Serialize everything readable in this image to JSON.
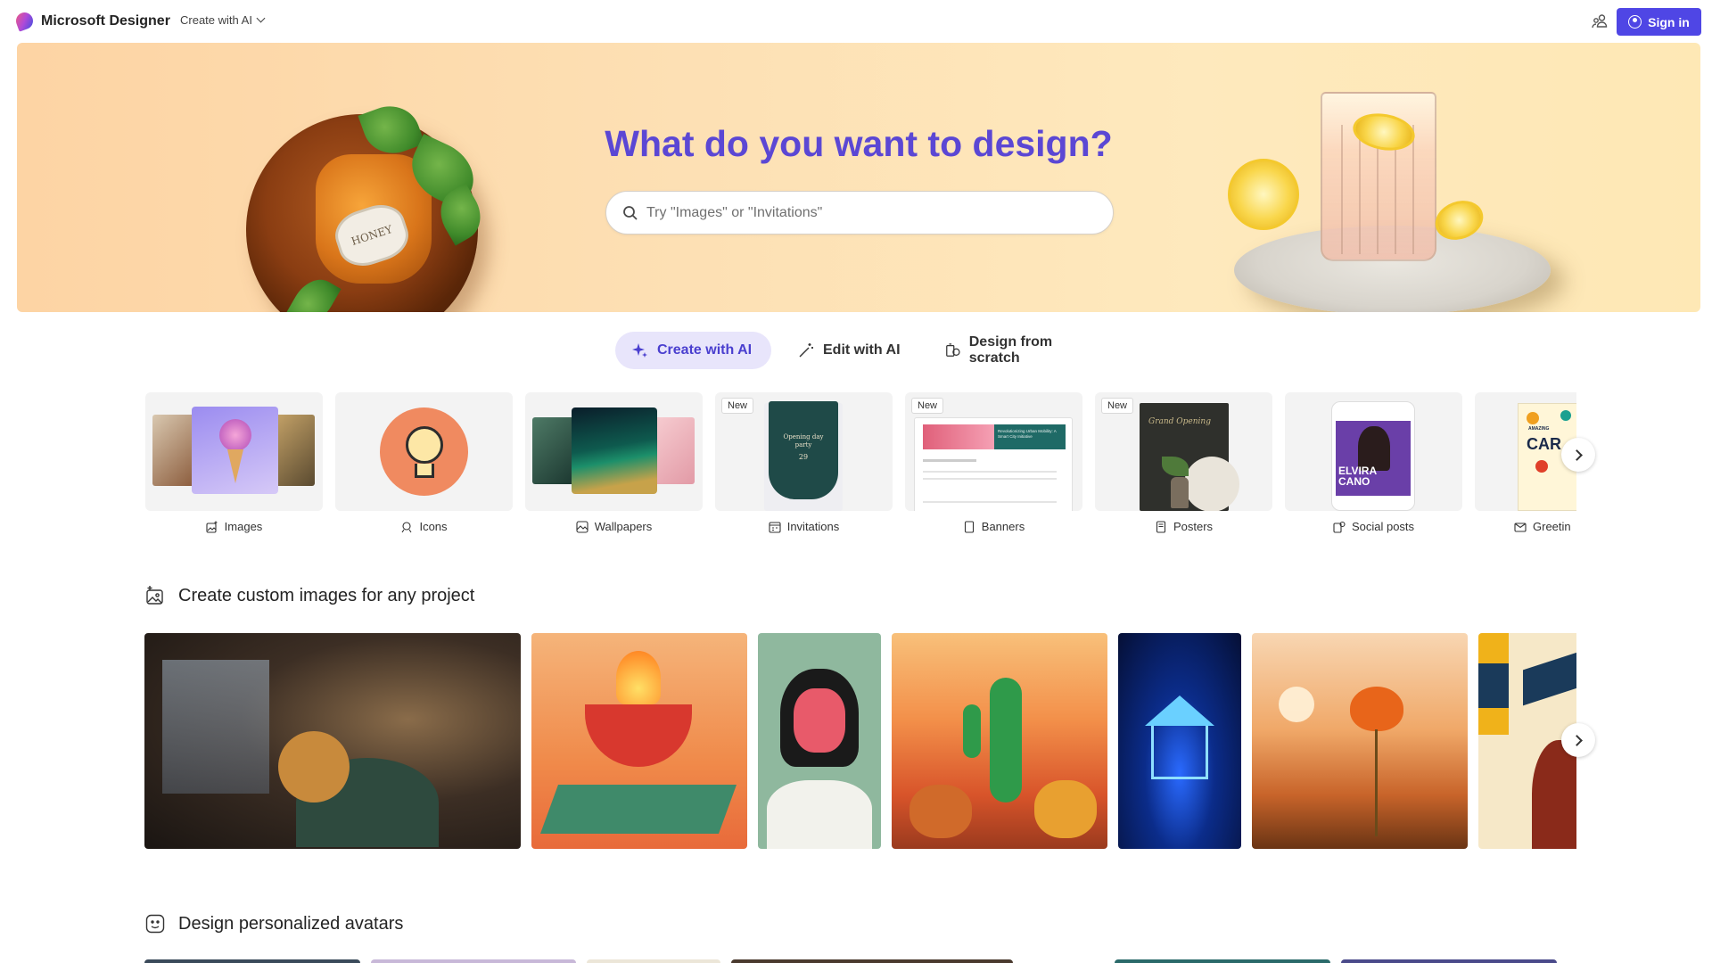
{
  "header": {
    "brand": "Microsoft Designer",
    "create_menu": "Create with AI",
    "sign_in": "Sign in"
  },
  "hero": {
    "title": "What do you want to design?",
    "search_placeholder": "Try \"Images\" or \"Invitations\"",
    "jar_label": "HONEY"
  },
  "modes": [
    {
      "label": "Create with AI",
      "active": true,
      "icon": "sparkle-icon"
    },
    {
      "label": "Edit with AI",
      "active": false,
      "icon": "magic-wand-icon"
    },
    {
      "label": "Design from scratch",
      "active": false,
      "icon": "shapes-icon"
    }
  ],
  "categories": [
    {
      "label": "Images",
      "new": false,
      "icon": "image-sparkle-icon"
    },
    {
      "label": "Icons",
      "new": false,
      "icon": "icon-shapes-icon"
    },
    {
      "label": "Wallpapers",
      "new": false,
      "icon": "wallpaper-icon"
    },
    {
      "label": "Invitations",
      "new": true,
      "icon": "calendar-icon",
      "card_text": "Opening day party",
      "card_date": "29"
    },
    {
      "label": "Banners",
      "new": true,
      "icon": "document-icon",
      "card_text": "Revolutionizing Urban Mobility: A Smart City Initiative"
    },
    {
      "label": "Posters",
      "new": true,
      "icon": "poster-icon",
      "card_text": "Grand Opening"
    },
    {
      "label": "Social posts",
      "new": false,
      "icon": "social-post-icon",
      "card_text": "ELVIRA CANO"
    },
    {
      "label": "Greetin",
      "new": false,
      "icon": "mail-icon",
      "card_text": "AMAZING"
    }
  ],
  "badges": {
    "new": "New"
  },
  "sections": {
    "images": "Create custom images for any project",
    "avatars": "Design personalized avatars"
  },
  "colors": {
    "accent": "#4f46e5",
    "hero_title": "#5b47d4",
    "active_mode_bg": "#e8e5fb"
  }
}
